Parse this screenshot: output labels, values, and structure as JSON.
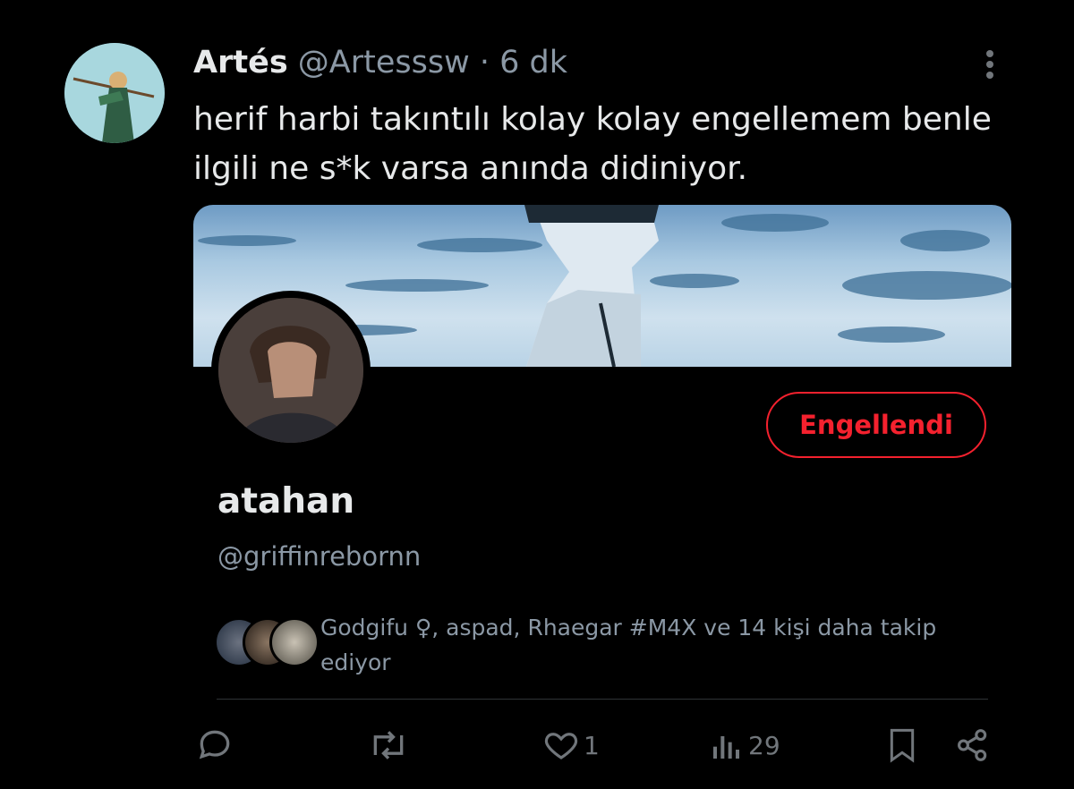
{
  "tweet": {
    "author_name": "Artés",
    "author_handle": "@Artesssw",
    "separator": "·",
    "time": "6 dk",
    "text": "herif harbi takıntılı kolay kolay engellemem benle ilgili ne s*k varsa anında didiniyor."
  },
  "card": {
    "blocked_button_label": "Engellendi",
    "profile_name": "atahan",
    "profile_handle": "@griffinrebornn",
    "followers_text": "Godgifu ♀, aspad, Rhaegar #M4X ve 14 kişi daha takip ediyor"
  },
  "actions": {
    "reply_icon": "reply-icon",
    "retweet_icon": "retweet-icon",
    "like_icon": "heart-icon",
    "like_count": "1",
    "views_icon": "views-icon",
    "views_count": "29",
    "bookmark_icon": "bookmark-icon",
    "share_icon": "share-icon"
  },
  "colors": {
    "background": "#000000",
    "text": "#e7e9ea",
    "muted": "#8b98a5",
    "danger": "#f4212e"
  }
}
